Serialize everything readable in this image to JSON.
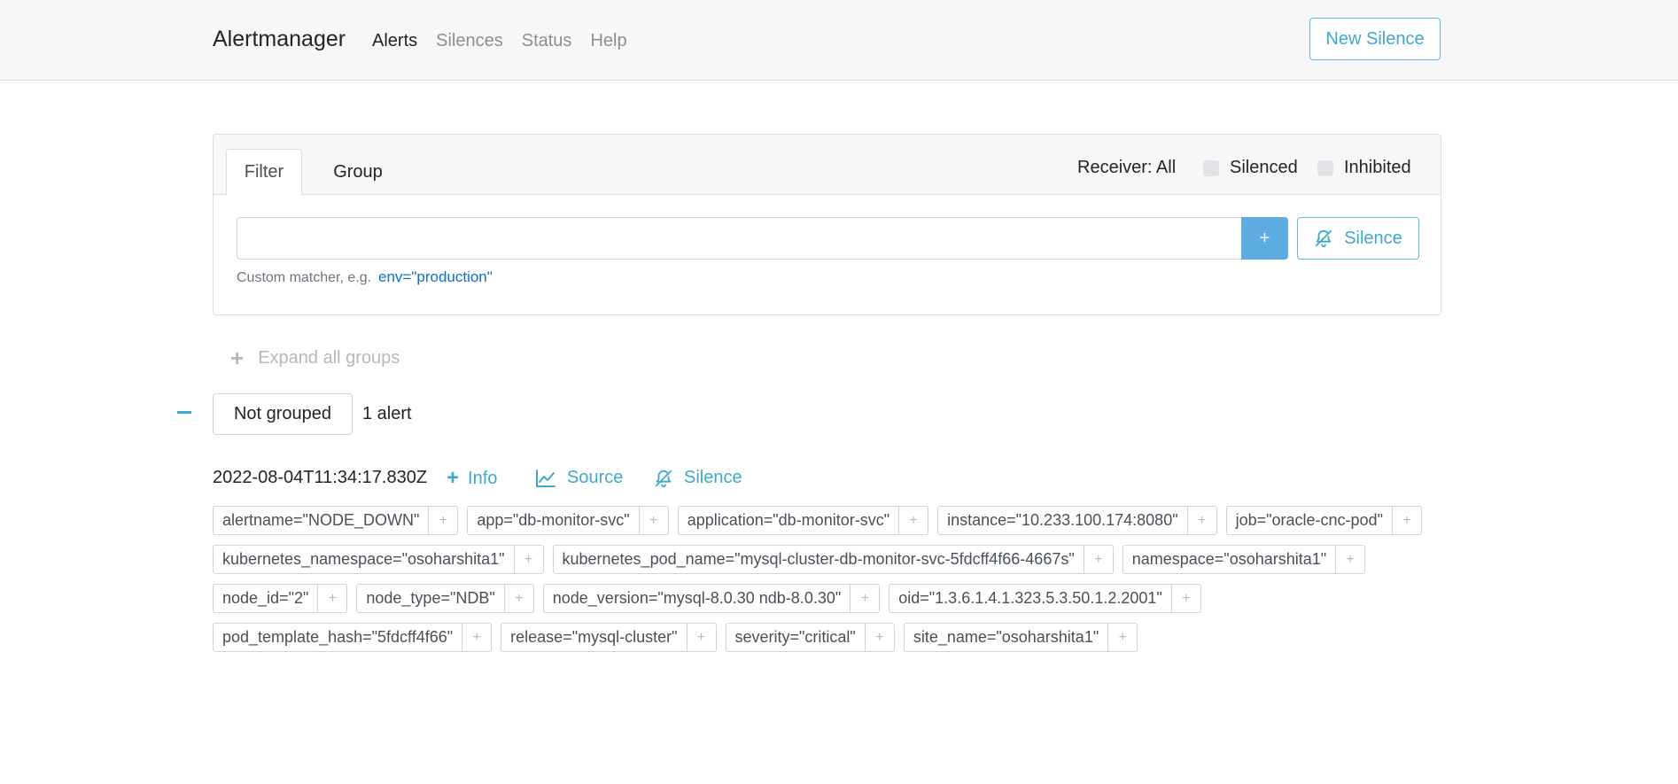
{
  "navbar": {
    "brand": "Alertmanager",
    "links": [
      {
        "label": "Alerts",
        "active": true
      },
      {
        "label": "Silences",
        "active": false
      },
      {
        "label": "Status",
        "active": false
      },
      {
        "label": "Help",
        "active": false
      }
    ],
    "new_silence_label": "New Silence"
  },
  "filter_card": {
    "tabs": [
      "Filter",
      "Group"
    ],
    "active_tab": "Filter",
    "receiver_label": "Receiver: All",
    "silenced_label": "Silenced",
    "silenced_checked": false,
    "inhibited_label": "Inhibited",
    "inhibited_checked": false,
    "input_value": "",
    "add_button_label": "+",
    "silence_button_label": "Silence",
    "hint_text": "Custom matcher, e.g.",
    "hint_example": "env=\"production\""
  },
  "expand_all_label": "Expand all groups",
  "group": {
    "label": "Not grouped",
    "count_label": "1 alert"
  },
  "alert": {
    "timestamp": "2022-08-04T11:34:17.830Z",
    "info_label": "Info",
    "source_label": "Source",
    "silence_label": "Silence",
    "label_rows": [
      [
        "alertname=\"NODE_DOWN\"",
        "app=\"db-monitor-svc\"",
        "application=\"db-monitor-svc\"",
        "instance=\"10.233.100.174:8080\"",
        "job=\"oracle-cnc-pod\""
      ],
      [
        "kubernetes_namespace=\"osoharshita1\"",
        "kubernetes_pod_name=\"mysql-cluster-db-monitor-svc-5fdcff4f66-4667s\"",
        "namespace=\"osoharshita1\""
      ],
      [
        "node_id=\"2\"",
        "node_type=\"NDB\"",
        "node_version=\"mysql-8.0.30 ndb-8.0.30\"",
        "oid=\"1.3.6.1.4.1.323.5.3.50.1.2.2001\""
      ],
      [
        "pod_template_hash=\"5fdcff4f66\"",
        "release=\"mysql-cluster\"",
        "severity=\"critical\"",
        "site_name=\"osoharshita1\""
      ]
    ],
    "label_add_glyph": "+"
  },
  "colors": {
    "accent": "#3fa8cc",
    "primary_button": "#5dade2",
    "navbar_bg": "#f7f7f7",
    "link_example": "#0f6fc5"
  }
}
